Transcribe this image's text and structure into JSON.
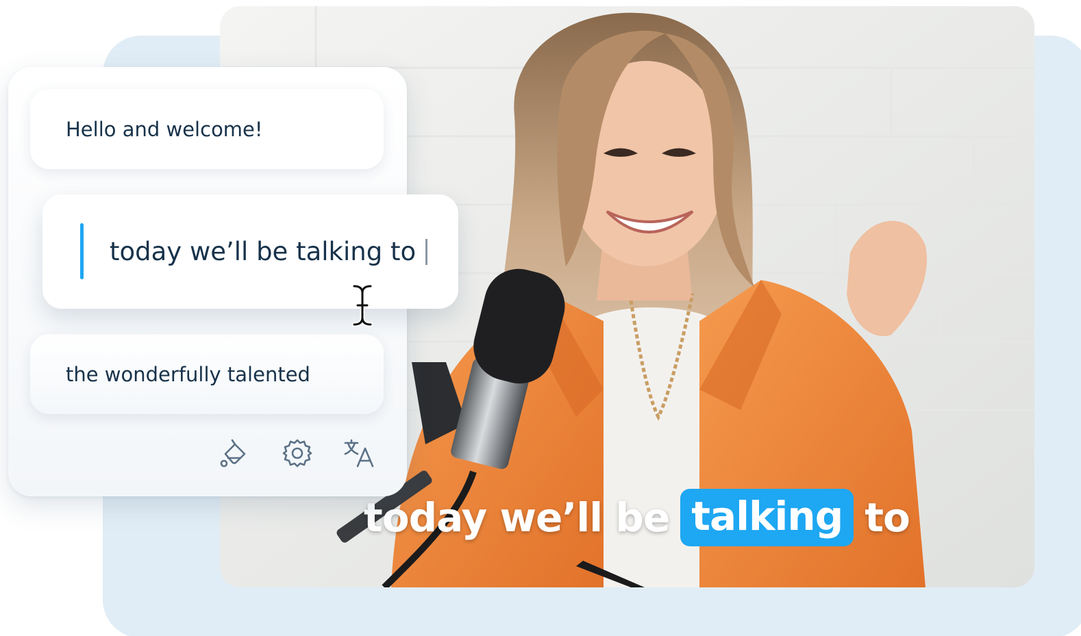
{
  "subtitle_editor": {
    "segments": [
      {
        "text": "Hello and welcome!"
      },
      {
        "text": "today we’ll be talking to"
      },
      {
        "text": "the wonderfully talented"
      }
    ],
    "active_segment_index": 1,
    "toolbar": {
      "icons": [
        "paint-bucket-icon",
        "gear-icon",
        "translate-icon"
      ]
    }
  },
  "video": {
    "caption": {
      "before": "today we’ll be",
      "highlighted": "talking",
      "after": "to"
    },
    "highlight_color": "#1ea7f2"
  },
  "colors": {
    "accent": "#1ea7f2",
    "backdrop": "#e1edf6",
    "text": "#17324a",
    "jacket": "#f0883a"
  }
}
